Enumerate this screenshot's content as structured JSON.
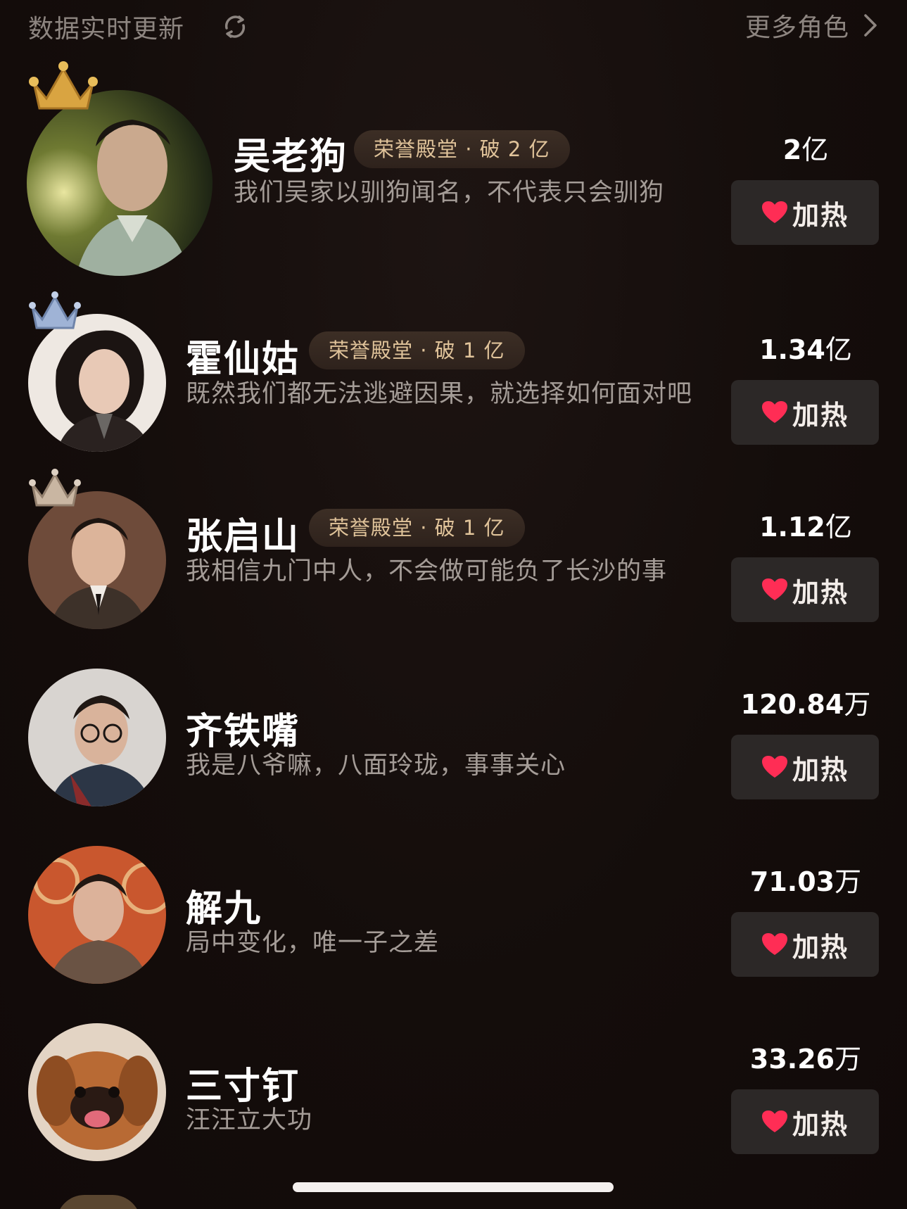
{
  "header": {
    "status_text": "数据实时更新",
    "refresh_icon": "refresh-icon",
    "more_label": "更多角色",
    "chevron_icon": "chevron-right-icon"
  },
  "colors": {
    "background": "#130c0a",
    "badge_text": "#e0c39a",
    "heart": "#ff2d55",
    "button_bg": "#2c2827",
    "crown_gold": "#d9a441",
    "crown_silver": "#9fb3d6",
    "crown_bronze": "#c9b6a2"
  },
  "roles": [
    {
      "rank": 1,
      "name": "吴老狗",
      "badge": "荣誉殿堂 · 破 2 亿",
      "quote": "我们吴家以驯狗闻名，不代表只会驯狗",
      "count_value": "2",
      "count_unit": "亿",
      "button_label": "加热",
      "crown": "gold-crown-icon"
    },
    {
      "rank": 2,
      "name": "霍仙姑",
      "badge": "荣誉殿堂 · 破 1 亿",
      "quote": "既然我们都无法逃避因果，就选择如何面对吧",
      "count_value": "1.34",
      "count_unit": "亿",
      "button_label": "加热",
      "crown": "silver-crown-icon"
    },
    {
      "rank": 3,
      "name": "张启山",
      "badge": "荣誉殿堂 · 破 1 亿",
      "quote": "我相信九门中人，不会做可能负了长沙的事",
      "count_value": "1.12",
      "count_unit": "亿",
      "button_label": "加热",
      "crown": "bronze-crown-icon"
    },
    {
      "rank": 4,
      "name": "齐铁嘴",
      "badge": "",
      "quote": "我是八爷嘛，八面玲珑，事事关心",
      "count_value": "120.84",
      "count_unit": "万",
      "button_label": "加热",
      "crown": ""
    },
    {
      "rank": 5,
      "name": "解九",
      "badge": "",
      "quote": "局中变化，唯一子之差",
      "count_value": "71.03",
      "count_unit": "万",
      "button_label": "加热",
      "crown": ""
    },
    {
      "rank": 6,
      "name": "三寸钉",
      "badge": "",
      "quote": "汪汪立大功",
      "count_value": "33.26",
      "count_unit": "万",
      "button_label": "加热",
      "crown": ""
    }
  ]
}
